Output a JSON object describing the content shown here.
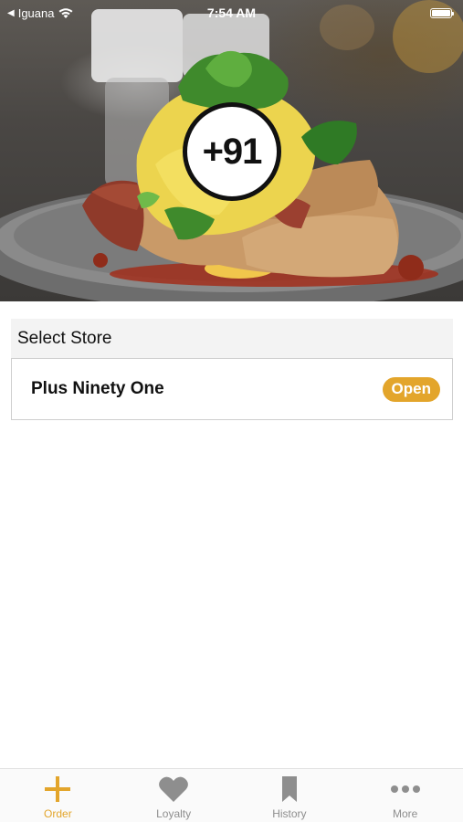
{
  "status_bar": {
    "back_app": "Iguana",
    "time": "7:54 AM"
  },
  "hero": {
    "logo_text": "+91"
  },
  "store_section": {
    "header": "Select Store",
    "stores": [
      {
        "name": "Plus Ninety One",
        "status": "Open"
      }
    ]
  },
  "tab_bar": {
    "tabs": [
      {
        "label": "Order",
        "icon": "plus-icon",
        "active": true
      },
      {
        "label": "Loyalty",
        "icon": "heart-icon",
        "active": false
      },
      {
        "label": "History",
        "icon": "bookmark-icon",
        "active": false
      },
      {
        "label": "More",
        "icon": "more-dots-icon",
        "active": false
      }
    ]
  },
  "colors": {
    "accent": "#e3a52b",
    "inactive_tab": "#8e8e8e",
    "section_header_bg": "#f3f3f3"
  }
}
